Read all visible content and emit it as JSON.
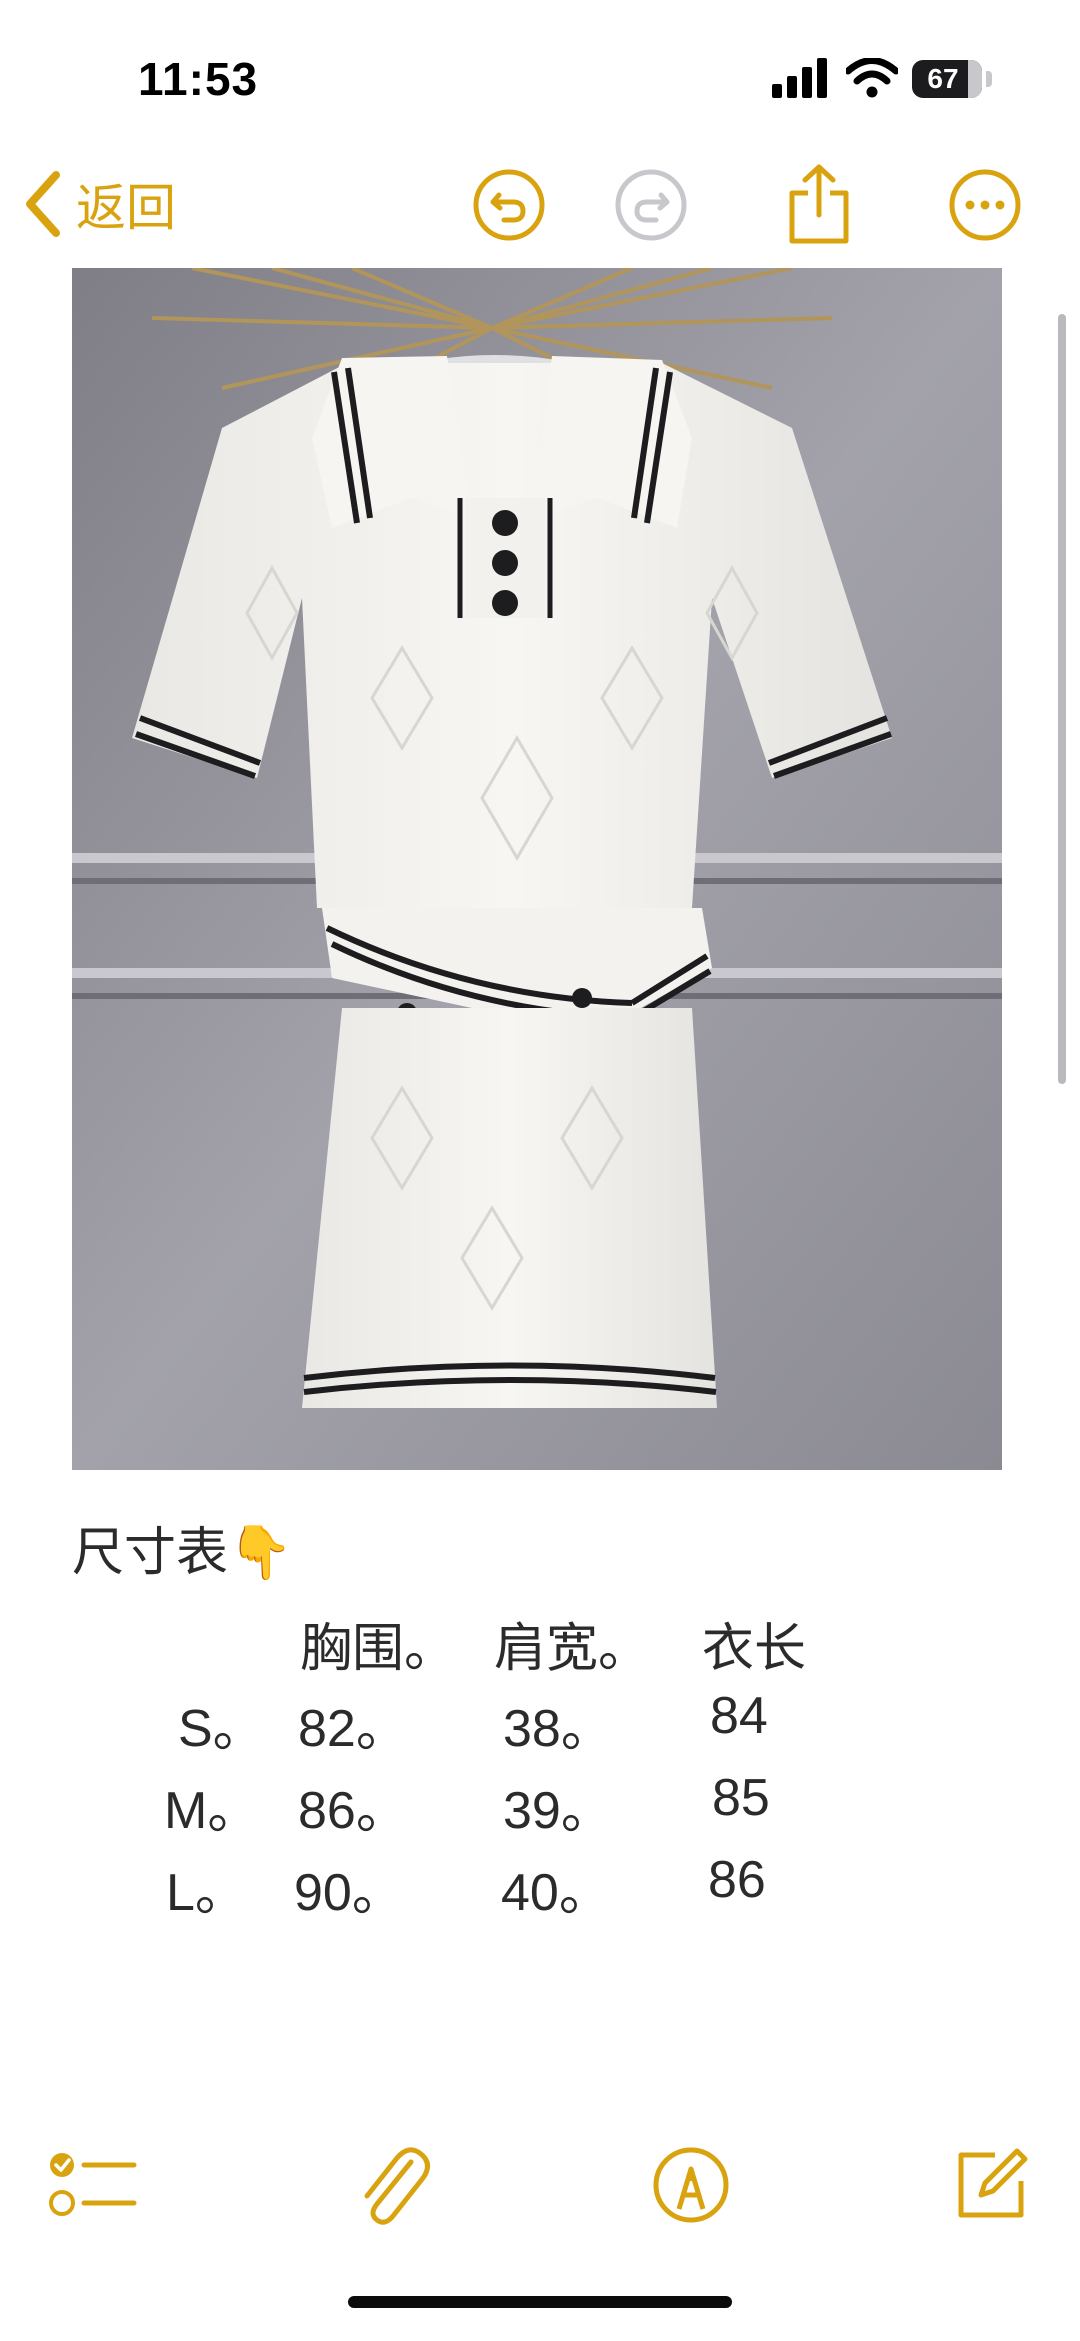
{
  "status_bar": {
    "time": "11:53",
    "battery": "67"
  },
  "nav": {
    "back_label": "返回"
  },
  "note": {
    "heading": "尺寸表",
    "heading_emoji": "👇",
    "size_table": {
      "headers": [
        "胸围。",
        "肩宽。",
        "衣长"
      ],
      "rows": [
        {
          "size": "S。",
          "chest": "82。",
          "shoulder": "38。",
          "length": "84"
        },
        {
          "size": "M。",
          "chest": "86。",
          "shoulder": "39。",
          "length": "85"
        },
        {
          "size": "L。",
          "chest": "90。",
          "shoulder": "40。",
          "length": "86"
        }
      ]
    }
  },
  "icons": {
    "back": "chevron-left-icon",
    "undo": "undo-icon",
    "redo": "redo-icon",
    "share": "share-icon",
    "more": "more-icon",
    "checklist": "checklist-icon",
    "attachment": "paperclip-icon",
    "markup": "markup-icon",
    "compose": "compose-icon"
  },
  "colors": {
    "accent": "#d9a30f",
    "disabled": "#c7c7cc",
    "text": "#2b2b2b",
    "photo_background": "#9c9ba3"
  }
}
